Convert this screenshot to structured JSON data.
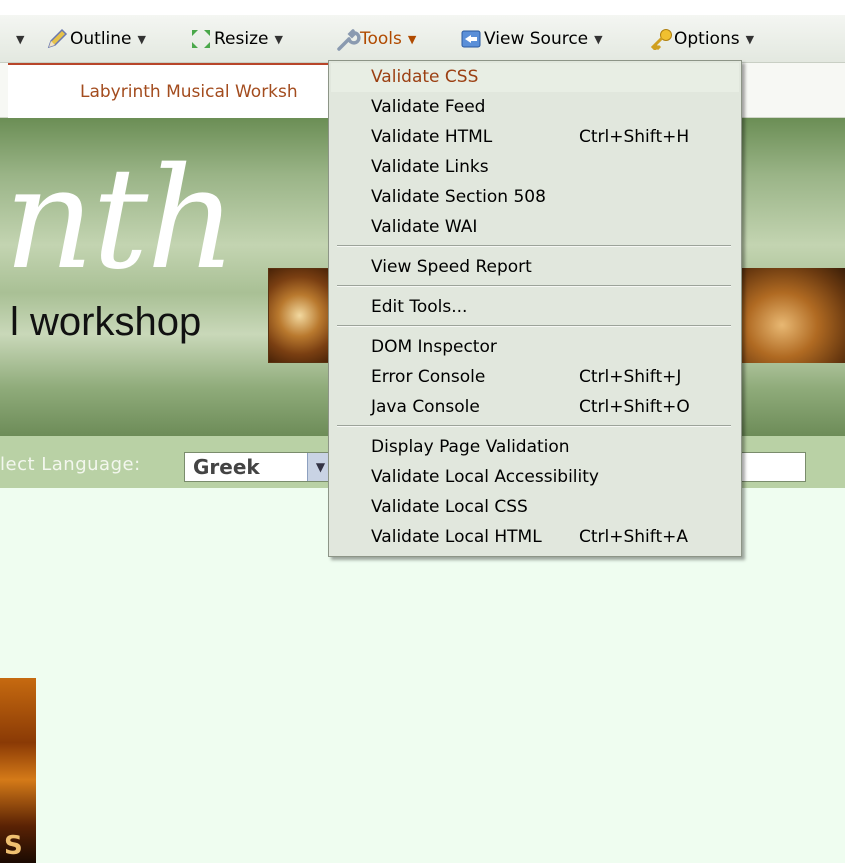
{
  "toolbar": {
    "outline_label": "Outline",
    "resize_label": "Resize",
    "tools_label": "Tools",
    "view_source_label": "View Source",
    "options_label": "Options"
  },
  "tab": {
    "title": "Labyrinth Musical Worksh"
  },
  "banner": {
    "title": "nth",
    "subtitle": "l   workshop"
  },
  "language": {
    "label": "lect Language:",
    "selected": "Greek"
  },
  "thumb": {
    "text": "S"
  },
  "menu": {
    "items": [
      {
        "label": "Validate CSS",
        "shortcut": ""
      },
      {
        "label": "Validate Feed",
        "shortcut": ""
      },
      {
        "label": "Validate HTML",
        "shortcut": "Ctrl+Shift+H"
      },
      {
        "label": "Validate Links",
        "shortcut": ""
      },
      {
        "label": "Validate Section 508",
        "shortcut": ""
      },
      {
        "label": "Validate WAI",
        "shortcut": ""
      },
      {
        "label": "View Speed Report",
        "shortcut": ""
      },
      {
        "label": "Edit Tools...",
        "shortcut": ""
      },
      {
        "label": "DOM Inspector",
        "shortcut": ""
      },
      {
        "label": "Error Console",
        "shortcut": "Ctrl+Shift+J"
      },
      {
        "label": "Java Console",
        "shortcut": "Ctrl+Shift+O"
      },
      {
        "label": "Display Page Validation",
        "shortcut": ""
      },
      {
        "label": "Validate Local Accessibility",
        "shortcut": ""
      },
      {
        "label": "Validate Local CSS",
        "shortcut": ""
      },
      {
        "label": "Validate Local HTML",
        "shortcut": "Ctrl+Shift+A"
      }
    ]
  },
  "colors": {
    "menu_bg": "#e1e7dd",
    "highlight_text": "#9b3f12",
    "banner_green": "#9ab487",
    "content_bg": "#effdf0"
  }
}
